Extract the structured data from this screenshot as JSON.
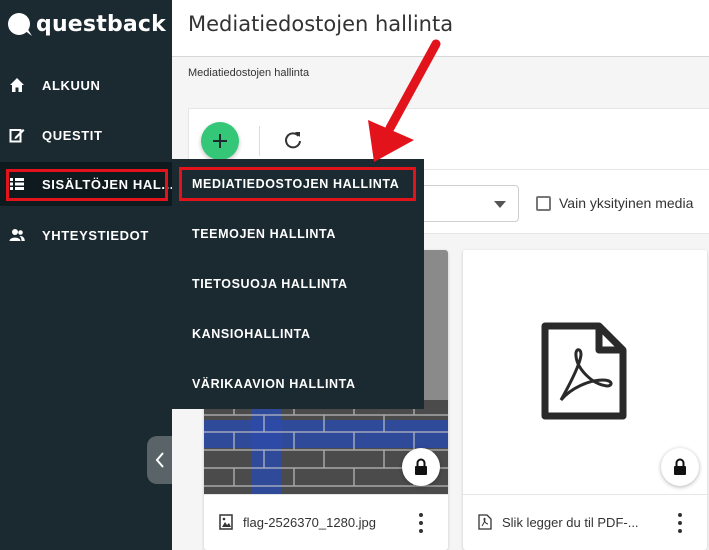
{
  "brand": {
    "name": "questback"
  },
  "sidebar": {
    "items": [
      {
        "label": "ALKUUN",
        "icon": "home-icon"
      },
      {
        "label": "QUESTIT",
        "icon": "edit-icon"
      },
      {
        "label": "SISÄLTÖJEN HAL...",
        "icon": "list-icon"
      },
      {
        "label": "YHTEYSTIEDOT",
        "icon": "contacts-icon"
      }
    ]
  },
  "header": {
    "title": "Mediatiedostojen hallinta"
  },
  "breadcrumb": "Mediatiedostojen hallinta",
  "flyout": {
    "items": [
      {
        "label": "MEDIATIEDOSTOJEN HALLINTA"
      },
      {
        "label": "TEEMOJEN HALLINTA"
      },
      {
        "label": "TIETOSUOJA HALLINTA"
      },
      {
        "label": "KANSIOHALLINTA"
      },
      {
        "label": "VÄRIKAAVION HALLINTA"
      }
    ]
  },
  "filters": {
    "private_only_label": "Vain yksityinen media"
  },
  "cards": [
    {
      "file_name": "flag-2526370_1280.jpg",
      "type_icon": "image-icon"
    },
    {
      "file_name": "Slik legger du til PDF-...",
      "type_icon": "pdf-file-icon"
    }
  ],
  "colors": {
    "sidebar_bg": "#1b2a30",
    "accent_green": "#35c778",
    "annotation_red": "#e3131b"
  }
}
